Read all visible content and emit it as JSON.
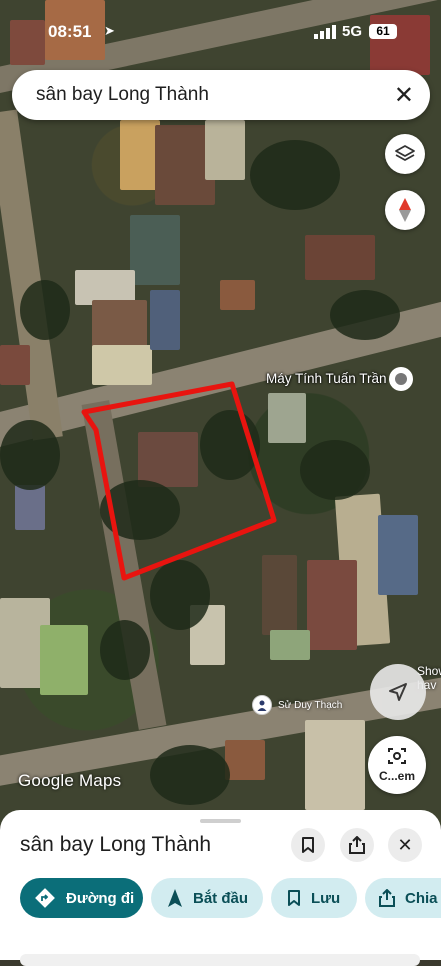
{
  "status_bar": {
    "time": "08:51",
    "network": "5G",
    "battery": "61"
  },
  "search": {
    "query": "sân bay Long Thành"
  },
  "map": {
    "poi_label": "Máy Tính Tuấn Trần",
    "show_label": "Show\nhav",
    "user_label": "Sử Duy Thạch",
    "camera_label": "C...em",
    "brand": "Google Maps"
  },
  "sheet": {
    "title": "sân bay Long Thành",
    "chips": {
      "directions": "Đường đi",
      "start": "Bắt đầu",
      "save": "Lưu",
      "share": "Chia"
    }
  },
  "colors": {
    "accent": "#0b6e79",
    "chip_secondary": "#d2ecf0",
    "highlight": "#e8140f"
  }
}
